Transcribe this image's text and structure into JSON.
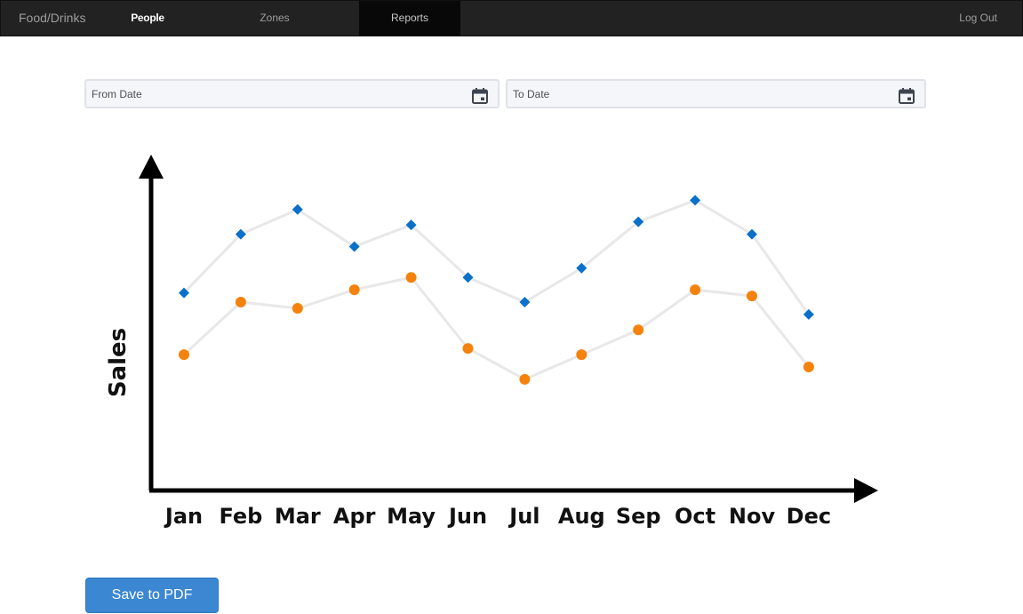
{
  "nav": {
    "brand": "Food/Drinks",
    "items": [
      {
        "label": "People"
      },
      {
        "label": "Zones"
      },
      {
        "label": "Reports"
      }
    ],
    "logout": "Log Out"
  },
  "filters": {
    "from_placeholder": "From Date",
    "to_placeholder": "To Date",
    "icon": "calendar-icon"
  },
  "chart_data": {
    "type": "line",
    "ylabel": "Sales",
    "xlabel": "",
    "categories": [
      "Jan",
      "Feb",
      "Mar",
      "Apr",
      "May",
      "Jun",
      "Jul",
      "Aug",
      "Sep",
      "Oct",
      "Nov",
      "Dec"
    ],
    "series": [
      {
        "marker": "diamond",
        "color": "#0a70c9",
        "values": [
          64,
          83,
          91,
          79,
          86,
          69,
          61,
          72,
          87,
          94,
          83,
          57
        ]
      },
      {
        "marker": "circle",
        "color": "#f5820d",
        "values": [
          44,
          61,
          59,
          65,
          69,
          46,
          36,
          44,
          52,
          65,
          63,
          40
        ]
      }
    ],
    "ylim": [
      0,
      100
    ],
    "grid": false,
    "legend": "none",
    "line_color": "#e8e8ea"
  },
  "actions": {
    "save_label": "Save to PDF"
  }
}
